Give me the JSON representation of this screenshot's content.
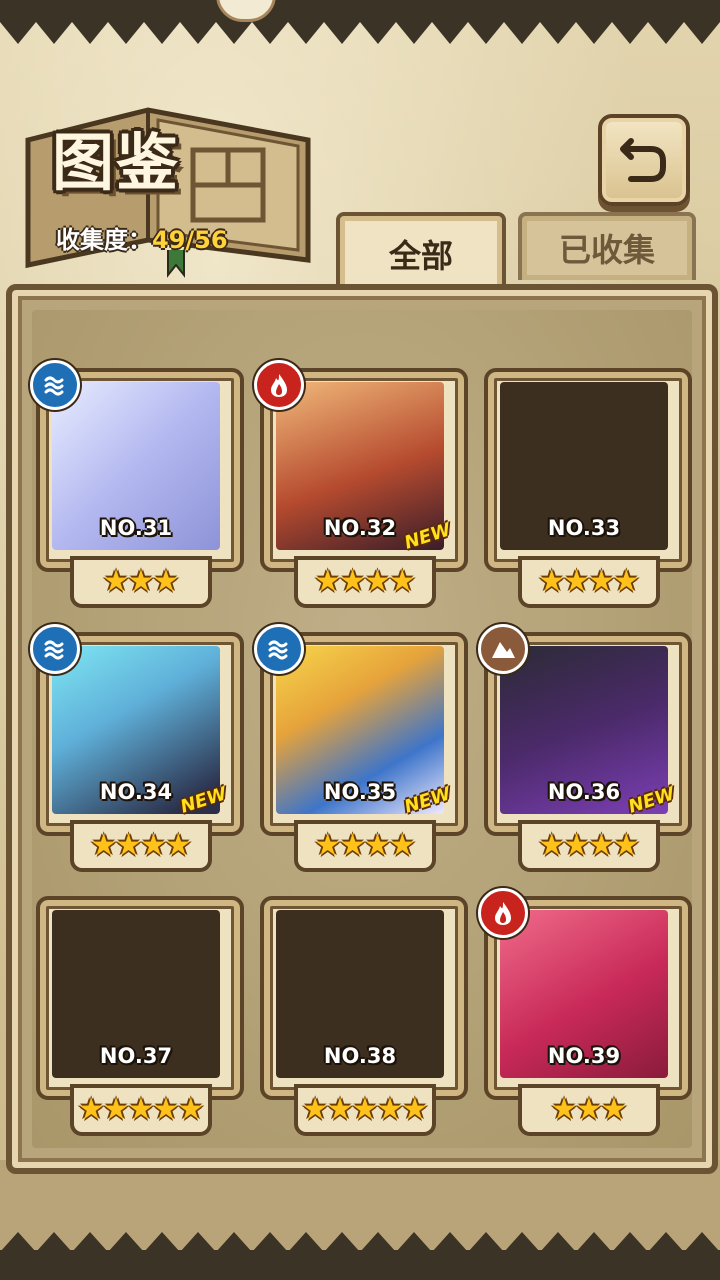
{
  "header": {
    "title": "图鉴",
    "progress_label": "收集度：",
    "progress_value": "49/56"
  },
  "tabs": [
    {
      "label": "全部",
      "active": true
    },
    {
      "label": "已收集",
      "active": false
    }
  ],
  "colors": {
    "water": "#1e6fb6",
    "fire": "#c8231d",
    "earth": "#8a5a3a",
    "star": "#ffc21a",
    "new_tag": "#ffe01a"
  },
  "cards": [
    {
      "no": "NO.31",
      "stars": 3,
      "element": "water-icon",
      "locked": false,
      "new": false
    },
    {
      "no": "NO.32",
      "stars": 4,
      "element": "fire-icon",
      "locked": false,
      "new": true,
      "new_label": "NEW"
    },
    {
      "no": "NO.33",
      "stars": 4,
      "element": "",
      "locked": true,
      "new": false
    },
    {
      "no": "NO.34",
      "stars": 4,
      "element": "water-icon",
      "locked": false,
      "new": true,
      "new_label": "NEW"
    },
    {
      "no": "NO.35",
      "stars": 4,
      "element": "water-icon",
      "locked": false,
      "new": true,
      "new_label": "NEW"
    },
    {
      "no": "NO.36",
      "stars": 4,
      "element": "earth-icon",
      "locked": false,
      "new": true,
      "new_label": "NEW"
    },
    {
      "no": "NO.37",
      "stars": 5,
      "element": "",
      "locked": true,
      "new": false
    },
    {
      "no": "NO.38",
      "stars": 5,
      "element": "",
      "locked": true,
      "new": false
    },
    {
      "no": "NO.39",
      "stars": 3,
      "element": "fire-icon",
      "locked": false,
      "new": false
    }
  ]
}
